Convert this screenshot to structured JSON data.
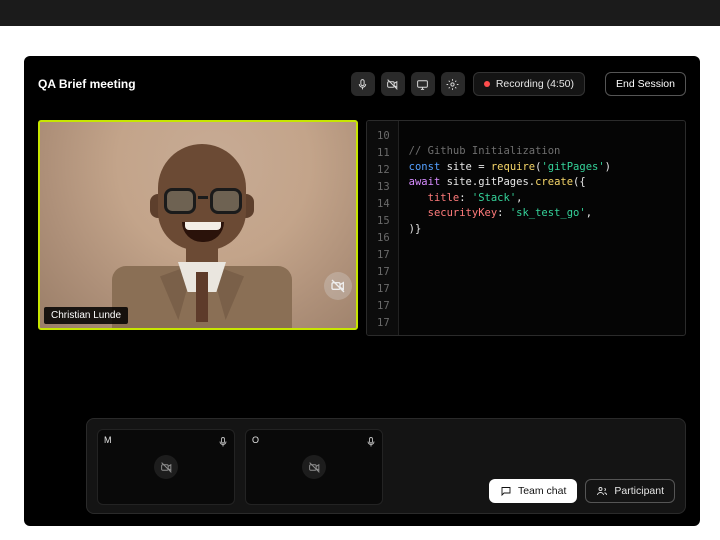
{
  "header": {
    "title": "QA Brief meeting",
    "recording_label": "Recording (4:50)",
    "end_label": "End Session",
    "tool_icons": [
      "mic-icon",
      "camera-off-icon",
      "screen-share-icon",
      "settings-icon"
    ]
  },
  "video": {
    "speaker_name": "Christian Lunde"
  },
  "code": {
    "line_numbers": [
      "10",
      "11",
      "12",
      "13",
      "14",
      "15",
      "16",
      "17",
      "17",
      "17",
      "17",
      "17"
    ],
    "lines": {
      "l11_comment": "// Github Initialization",
      "l12_kw": "const ",
      "l12_id": "site",
      "l12_op1": " = ",
      "l12_fn": "require",
      "l12_paren1": "(",
      "l12_str": "'gitPages'",
      "l12_paren2": ")",
      "l13_await": "await ",
      "l13_obj": "site.gitPages.",
      "l13_fn": "create",
      "l13_tail": "({",
      "l14_indent": "   ",
      "l14_prop": "title",
      "l14_colon": ": ",
      "l14_str": "'Stack'",
      "l14_comma": ",",
      "l15_indent": "   ",
      "l15_prop": "securityKey",
      "l15_colon": ": ",
      "l15_str": "'sk_test_go'",
      "l15_comma": ",",
      "l16_close": ")}"
    }
  },
  "thumbnails": [
    {
      "label": "M"
    },
    {
      "label": "O"
    }
  ],
  "actions": {
    "chat_label": "Team chat",
    "participant_label": "Participant"
  }
}
